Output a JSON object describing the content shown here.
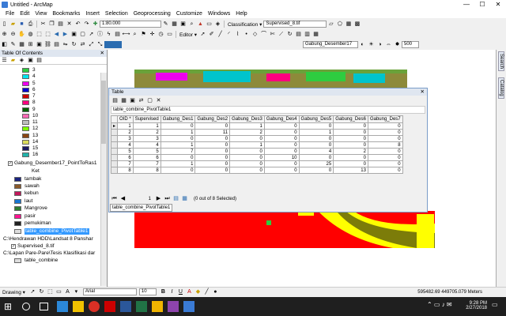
{
  "window": {
    "title": "Untitled - ArcMap",
    "min": "—",
    "max": "☐",
    "close": "✕"
  },
  "menu": [
    "File",
    "Edit",
    "View",
    "Bookmarks",
    "Insert",
    "Selection",
    "Geoprocessing",
    "Customize",
    "Windows",
    "Help"
  ],
  "toolbar": {
    "scale": "1:80.000",
    "classification_label": "Classification ▾",
    "raster_layer": "Supervised_8.tif",
    "editor_label": "Editor ▾",
    "layer_combo": "Gabung_Desember17",
    "brightness": "500"
  },
  "toc": {
    "title": "Table Of Contents",
    "close": "✕",
    "classes": [
      {
        "label": "3",
        "color": "#2ecc40"
      },
      {
        "label": "4",
        "color": "#00e5ee"
      },
      {
        "label": "5",
        "color": "#ee00ee"
      },
      {
        "label": "6",
        "color": "#0000cd"
      },
      {
        "label": "7",
        "color": "#cd0000"
      },
      {
        "label": "8",
        "color": "#ff007f"
      },
      {
        "label": "9",
        "color": "#006400"
      },
      {
        "label": "10",
        "color": "#ff69b4"
      },
      {
        "label": "11",
        "color": "#bfbfbf"
      },
      {
        "label": "12",
        "color": "#7fff00"
      },
      {
        "label": "13",
        "color": "#8b4513"
      },
      {
        "label": "14",
        "color": "#dadc5a"
      },
      {
        "label": "15",
        "color": "#1a1a60"
      },
      {
        "label": "16",
        "color": "#20b2aa"
      }
    ],
    "point_layer": "Gabung_Desember17_PointToRas1",
    "point_field": "Ket",
    "point_classes": [
      {
        "label": "tambak",
        "color": "#1a237e"
      },
      {
        "label": "sawah",
        "color": "#8b5a2b"
      },
      {
        "label": "kebun",
        "color": "#c2185b"
      },
      {
        "label": "laut",
        "color": "#1976d2"
      },
      {
        "label": "Mangrove",
        "color": "#2e7d32"
      },
      {
        "label": "pasir",
        "color": "#ff1493"
      },
      {
        "label": "pemukiman",
        "color": "#212121"
      }
    ],
    "selected_table": "table_combine_PivotTable1",
    "group1": "C:\\Hendrawan HDD\\Landsat 8 Panshar",
    "group1_layer": "Supervised_8.tif",
    "group2": "C:\\Lapan Pare-Pare\\Tesis Klasifikasi dar",
    "group2_table": "table_combine"
  },
  "table": {
    "title": "Table",
    "close": "✕",
    "name": "table_combine_PivotTable1",
    "columns": [
      "OID *",
      "Supervised",
      "Gabung_Des1",
      "Gabung_Des2",
      "Gabung_Des3",
      "Gabung_Des4",
      "Gabung_Des5",
      "Gabung_Des6",
      "Gabung_Des7"
    ],
    "rows": [
      [
        "",
        "1",
        "1",
        "0",
        "0",
        "1",
        "0",
        "0",
        "0",
        "0"
      ],
      [
        "",
        "2",
        "2",
        "1",
        "11",
        "2",
        "0",
        "1",
        "0",
        "0"
      ],
      [
        "",
        "3",
        "3",
        "0",
        "0",
        "0",
        "0",
        "0",
        "0",
        "0"
      ],
      [
        "",
        "4",
        "4",
        "1",
        "0",
        "1",
        "0",
        "0",
        "0",
        "8"
      ],
      [
        "",
        "5",
        "5",
        "7",
        "0",
        "0",
        "0",
        "4",
        "2",
        "0"
      ],
      [
        "",
        "6",
        "6",
        "0",
        "0",
        "0",
        "10",
        "0",
        "0",
        "0"
      ],
      [
        "",
        "7",
        "7",
        "1",
        "0",
        "0",
        "0",
        "25",
        "0",
        "0"
      ],
      [
        "",
        "8",
        "8",
        "0",
        "0",
        "0",
        "0",
        "0",
        "13",
        "0"
      ]
    ],
    "pager": "1",
    "selection": "(0 out of 8 Selected)",
    "tab_label": "table_combine_PivotTable1"
  },
  "right_tabs": [
    "Search",
    "Catalog"
  ],
  "drawing": {
    "label": "Drawing ▾",
    "font": "Arial",
    "size": "10",
    "bold": "B",
    "italic": "I",
    "underline": "U",
    "font_color": "A"
  },
  "status": {
    "coords": "595482.69  449705.079 Meters"
  },
  "taskbar": {
    "time": "9:28 PM",
    "date": "2/27/2018"
  }
}
